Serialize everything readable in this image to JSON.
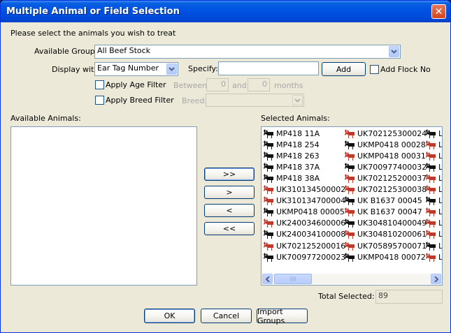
{
  "window": {
    "title": "Multiple Animal or Field Selection",
    "close_glyph": "✕"
  },
  "instruction": "Please select the animals you wish to treat",
  "groups": {
    "label": "Available Groups:",
    "value": "All Beef Stock"
  },
  "display": {
    "label": "Display with:",
    "value": "Ear Tag Number"
  },
  "specify": {
    "label": "Specify:",
    "value": ""
  },
  "add_button": "Add",
  "add_flock": {
    "label": "Add Flock No"
  },
  "age_filter": {
    "label": "Apply Age Filter",
    "between": "Between",
    "from": "0",
    "and": "and",
    "to": "0",
    "months": "months"
  },
  "breed_filter": {
    "label": "Apply Breed Filter",
    "breed": "Breed:",
    "value": ""
  },
  "available_animals": {
    "label": "Available Animals:"
  },
  "move_buttons": {
    "all_right": ">>",
    "right": ">",
    "left": "<",
    "all_left": "<<"
  },
  "selected_animals": {
    "label": "Selected Animals:",
    "col1": [
      {
        "tag": "MP418 11A",
        "icon": "black"
      },
      {
        "tag": "MP418 254",
        "icon": "black"
      },
      {
        "tag": "MP418 263",
        "icon": "black"
      },
      {
        "tag": "MP418 37A",
        "icon": "black"
      },
      {
        "tag": "MP418 38A",
        "icon": "black"
      },
      {
        "tag": "UK310134500002",
        "icon": "brown"
      },
      {
        "tag": "UK310134700004",
        "icon": "brown"
      },
      {
        "tag": "UKMP0418 00005",
        "icon": "black"
      },
      {
        "tag": "UK240034600006",
        "icon": "brown"
      },
      {
        "tag": "UK240034100008",
        "icon": "black"
      },
      {
        "tag": "UK702125200016",
        "icon": "brown"
      },
      {
        "tag": "UK700977200023",
        "icon": "black"
      }
    ],
    "col2": [
      {
        "tag": "UK702125300024",
        "icon": "brown"
      },
      {
        "tag": "UKMP0418 00028",
        "icon": "black"
      },
      {
        "tag": "UKMP0418 00031",
        "icon": "brown"
      },
      {
        "tag": "UK700977400032",
        "icon": "black"
      },
      {
        "tag": "UK702125200037",
        "icon": "brown"
      },
      {
        "tag": "UK702125300038",
        "icon": "brown"
      },
      {
        "tag": "UK B1637 00045",
        "icon": "black"
      },
      {
        "tag": "UK B1637 00047",
        "icon": "brown"
      },
      {
        "tag": "UK304810400049",
        "icon": "black"
      },
      {
        "tag": "UK304810200061",
        "icon": "brown"
      },
      {
        "tag": "UK705895700071",
        "icon": "brown"
      },
      {
        "tag": "UKMP0418 00072",
        "icon": "black"
      }
    ],
    "col3": [
      {
        "tag": "L",
        "icon": "black"
      },
      {
        "tag": "L",
        "icon": "brown"
      },
      {
        "tag": "L",
        "icon": "brown"
      },
      {
        "tag": "L",
        "icon": "black"
      },
      {
        "tag": "L",
        "icon": "brown"
      },
      {
        "tag": "L",
        "icon": "brown"
      },
      {
        "tag": "L",
        "icon": "black"
      },
      {
        "tag": "L",
        "icon": "brown"
      },
      {
        "tag": "L",
        "icon": "brown"
      },
      {
        "tag": "L",
        "icon": "brown"
      },
      {
        "tag": "L",
        "icon": "black"
      },
      {
        "tag": "L",
        "icon": "brown"
      }
    ]
  },
  "total_selected": {
    "label": "Total Selected:",
    "value": "89"
  },
  "footer": {
    "ok": "OK",
    "cancel": "Cancel",
    "import": "Import Groups"
  },
  "colors": {
    "title_bar": "#0054e3",
    "dialog_bg": "#ece9d8",
    "cow_black": "#111111",
    "cow_brown": "#c0392b"
  }
}
